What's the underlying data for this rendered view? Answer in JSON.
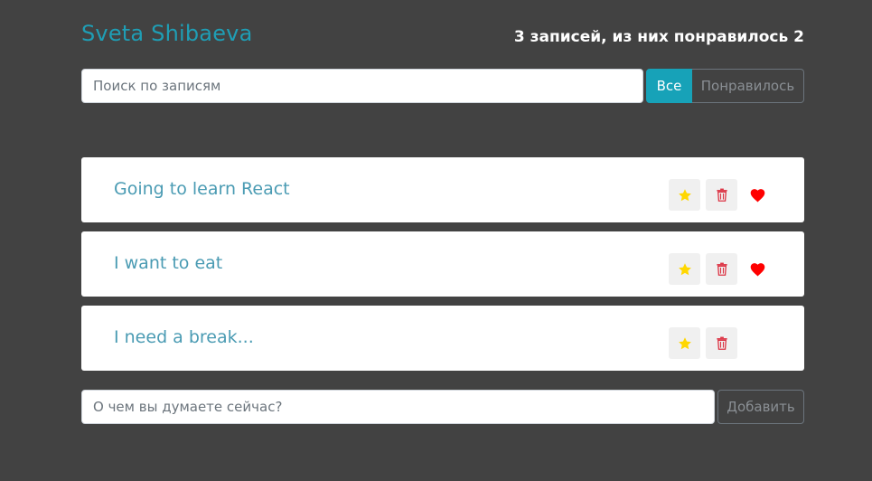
{
  "header": {
    "title": "Sveta Shibaeva",
    "stats": "3 записей, из них понравилось 2"
  },
  "search": {
    "placeholder": "Поиск по записям",
    "value": ""
  },
  "filters": [
    {
      "label": "Все",
      "active": true
    },
    {
      "label": "Понравилось",
      "active": false
    }
  ],
  "posts": [
    {
      "label": "Going to learn React",
      "important": true,
      "liked": true
    },
    {
      "label": "I want to eat",
      "important": true,
      "liked": true
    },
    {
      "label": "I need a break...",
      "important": true,
      "liked": false
    }
  ],
  "icons": {
    "star": "star-icon",
    "trash": "trash-icon",
    "heart": "heart-icon"
  },
  "colors": {
    "background": "#424242",
    "accent": "#17a2b8",
    "title": "#1f9eb5",
    "post_text": "#4a9bb3",
    "star": "#ffd700",
    "trash": "#dc3545",
    "heart": "#ff0000"
  },
  "add_form": {
    "placeholder": "О чем вы думаете сейчас?",
    "value": "",
    "button_label": "Добавить"
  }
}
